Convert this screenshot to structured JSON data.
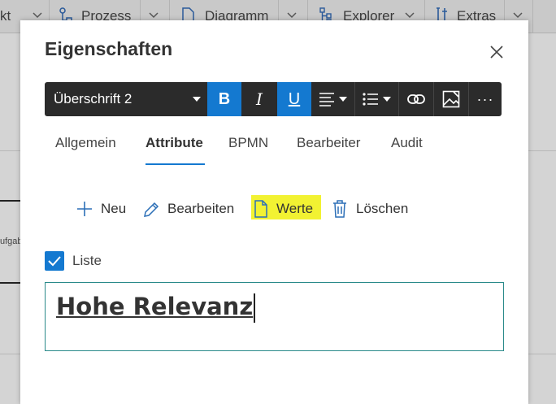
{
  "background": {
    "toolbar": {
      "partial_item": "kt",
      "items": [
        {
          "label": "Prozess",
          "icon": "process-flow-icon"
        },
        {
          "label": "Diagramm",
          "icon": "document-icon"
        },
        {
          "label": "Explorer",
          "icon": "tree-icon"
        },
        {
          "label": "Extras",
          "icon": "tools-icon"
        }
      ]
    },
    "side_text": "ufgab"
  },
  "dialog": {
    "title": "Eigenschaften",
    "close_icon": "close-icon",
    "toolbar": {
      "heading_select": "Überschrift 2",
      "bold": "B",
      "italic": "I",
      "underline": "U",
      "more": "···",
      "active_color": "#1479d0"
    },
    "tabs": [
      {
        "label": "Allgemein",
        "active": false
      },
      {
        "label": "Attribute",
        "active": true
      },
      {
        "label": "BPMN",
        "active": false
      },
      {
        "label": "Bearbeiter",
        "active": false
      },
      {
        "label": "Audit",
        "active": false
      }
    ],
    "actions": {
      "new": "Neu",
      "edit": "Bearbeiten",
      "values": "Werte",
      "delete": "Löschen",
      "highlight_color": "#f2f232"
    },
    "list_checkbox": {
      "label": "Liste",
      "checked": true
    },
    "editor": {
      "text": "Hohe Relevanz"
    }
  }
}
